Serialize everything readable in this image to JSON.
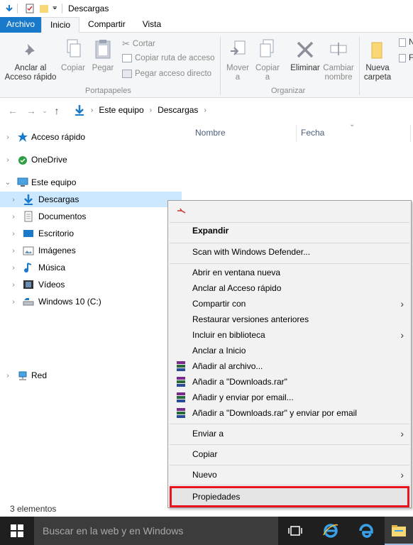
{
  "window": {
    "title": "Descargas"
  },
  "ribbon_tabs": [
    {
      "label": "Archivo"
    },
    {
      "label": "Inicio"
    },
    {
      "label": "Compartir"
    },
    {
      "label": "Vista"
    }
  ],
  "ribbon": {
    "pin_quick_access": "Anclar al\nAcceso rápido",
    "copy": "Copiar",
    "paste": "Pegar",
    "cut": "Cortar",
    "copy_path": "Copiar ruta de acceso",
    "paste_shortcut": "Pegar acceso directo",
    "clipboard_group": "Portapapeles",
    "move_to": "Mover\na",
    "copy_to": "Copiar\na",
    "delete": "Eliminar",
    "rename": "Cambiar\nnombre",
    "organize_group": "Organizar",
    "new_folder": "Nueva\ncarpeta",
    "group_new_fragment": "N"
  },
  "address": {
    "crumbs": [
      "Este equipo",
      "Descargas"
    ]
  },
  "nav_pane": {
    "items": [
      {
        "label": "Acceso rápido",
        "icon": "star-icon"
      },
      {
        "label": "OneDrive",
        "icon": "cloud-icon"
      },
      {
        "label": "Este equipo",
        "icon": "computer-icon"
      },
      {
        "label": "Descargas",
        "icon": "download-icon"
      },
      {
        "label": "Documentos",
        "icon": "document-icon"
      },
      {
        "label": "Escritorio",
        "icon": "desktop-icon"
      },
      {
        "label": "Imágenes",
        "icon": "pictures-icon"
      },
      {
        "label": "Música",
        "icon": "music-icon"
      },
      {
        "label": "Vídeos",
        "icon": "video-icon"
      },
      {
        "label": "Windows 10 (C:)",
        "icon": "drive-icon"
      },
      {
        "label": "Red",
        "icon": "network-icon"
      }
    ]
  },
  "content": {
    "col_name": "Nombre",
    "col_date": "Fecha"
  },
  "status_bar": {
    "count": "3 elementos"
  },
  "context_menu": {
    "items": [
      {
        "label": "Expandir"
      },
      {
        "label": "Scan with Windows Defender..."
      },
      {
        "label": "Abrir en ventana nueva"
      },
      {
        "label": "Anclar al Acceso rápido"
      },
      {
        "label": "Compartir con"
      },
      {
        "label": "Restaurar versiones anteriores"
      },
      {
        "label": "Incluir en biblioteca"
      },
      {
        "label": "Anclar a Inicio"
      },
      {
        "label": "Añadir al archivo..."
      },
      {
        "label": "Añadir a \"Downloads.rar\""
      },
      {
        "label": "Añadir y enviar por email..."
      },
      {
        "label": "Añadir a \"Downloads.rar\" y enviar por email"
      },
      {
        "label": "Enviar a"
      },
      {
        "label": "Copiar"
      },
      {
        "label": "Nuevo"
      },
      {
        "label": "Propiedades"
      }
    ]
  },
  "taskbar": {
    "search_placeholder": "Buscar en la web y en Windows"
  }
}
